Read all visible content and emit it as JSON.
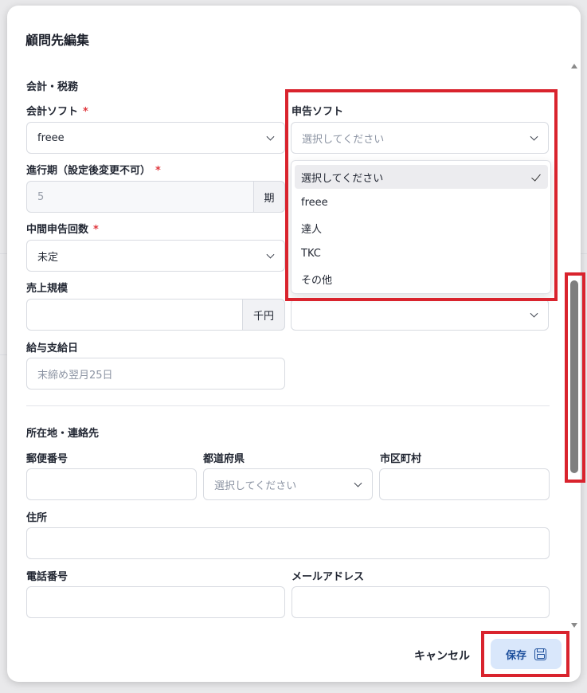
{
  "dialog": {
    "title": "顧問先編集"
  },
  "accounting": {
    "section_title": "会計・税務",
    "software": {
      "label": "会計ソフト",
      "required": "*",
      "value": "freee"
    },
    "tax_software": {
      "label": "申告ソフト",
      "placeholder": "選択してください"
    },
    "fiscal_period": {
      "label": "進行期（設定後変更不可）",
      "required": "*",
      "value": "5",
      "suffix": "期"
    },
    "interim_count": {
      "label": "中間申告回数",
      "required": "*",
      "value": "未定"
    },
    "sales_scale": {
      "label": "売上規模",
      "value": "",
      "suffix": "千円"
    },
    "payday": {
      "label": "給与支給日",
      "placeholder": "末締め翌月25日"
    }
  },
  "tax_software_dropdown": {
    "options": [
      "選択してください",
      "freee",
      "達人",
      "TKC",
      "その他"
    ],
    "selected": "選択してください"
  },
  "location": {
    "section_title": "所在地・連絡先",
    "postal_code": {
      "label": "郵便番号",
      "value": ""
    },
    "prefecture": {
      "label": "都道府県",
      "placeholder": "選択してください"
    },
    "city": {
      "label": "市区町村",
      "value": ""
    },
    "address": {
      "label": "住所",
      "value": ""
    },
    "phone": {
      "label": "電話番号",
      "value": ""
    },
    "email": {
      "label": "メールアドレス",
      "value": ""
    }
  },
  "footer": {
    "cancel_label": "キャンセル",
    "save_label": "保存"
  },
  "colors": {
    "highlight": "#d9232d",
    "save_button_bg": "#d9e7fb",
    "save_button_text": "#1d4f9c",
    "required": "#e0383e"
  }
}
